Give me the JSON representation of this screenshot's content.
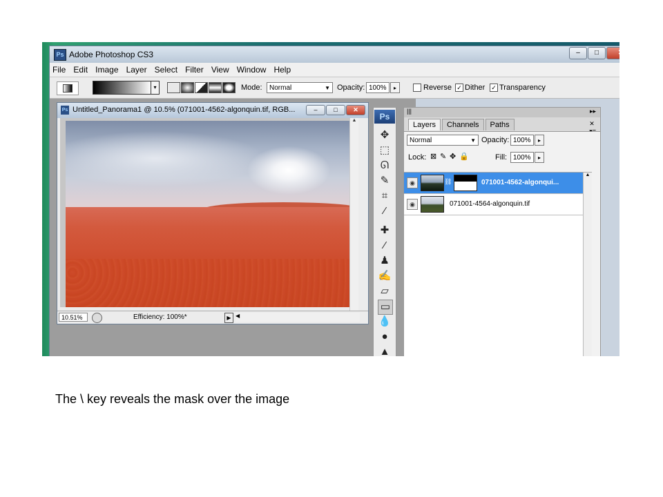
{
  "window": {
    "title": "Adobe Photoshop CS3",
    "ps_badge": "Ps",
    "buttons": {
      "minimize": "–",
      "maximize": "□",
      "close": "✕"
    }
  },
  "menu": [
    "File",
    "Edit",
    "Image",
    "Layer",
    "Select",
    "Filter",
    "View",
    "Window",
    "Help"
  ],
  "options_bar": {
    "mode_label": "Mode:",
    "mode_value": "Normal",
    "opacity_label": "Opacity:",
    "opacity_value": "100%",
    "reverse_label": "Reverse",
    "reverse_checked": false,
    "dither_label": "Dither",
    "dither_checked": true,
    "transparency_label": "Transparency",
    "transparency_checked": true
  },
  "document": {
    "icon_text": "Ps",
    "title": "Untitled_Panorama1 @ 10.5% (071001-4562-algonquin.tif, RGB...",
    "zoom": "10.51%",
    "status": "Efficiency: 100%*",
    "mask_overlay_color": "#d2452a"
  },
  "toolbox": {
    "logo": "Ps"
  },
  "layers_panel": {
    "tabs": [
      "Layers",
      "Channels",
      "Paths"
    ],
    "active_tab": "Layers",
    "blend_mode": "Normal",
    "opacity_label": "Opacity:",
    "opacity_value": "100%",
    "lock_label": "Lock:",
    "fill_label": "Fill:",
    "fill_value": "100%",
    "layers": [
      {
        "name": "071001-4562-algonqui...",
        "selected": true,
        "has_mask": true
      },
      {
        "name": "071001-4564-algonquin.tif",
        "selected": false,
        "has_mask": false
      }
    ]
  },
  "caption": "The \\ key reveals the mask over the image",
  "colors": {
    "selected_layer": "#3d8ee8",
    "desktop": "#1a6d70"
  }
}
